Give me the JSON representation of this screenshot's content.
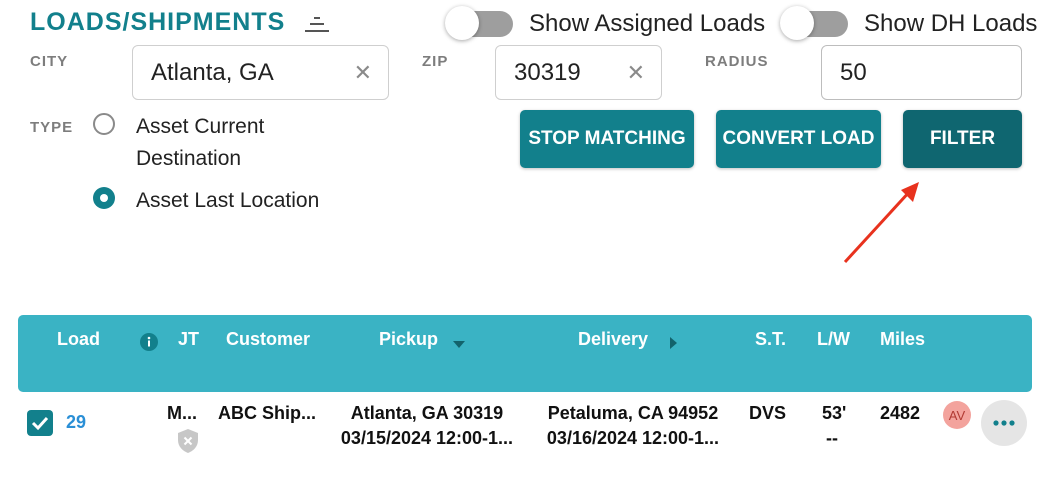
{
  "header": {
    "title": "LOADS/SHIPMENTS",
    "show_assigned_label": "Show Assigned Loads",
    "show_dh_label": "Show DH Loads"
  },
  "filters": {
    "city_label": "CITY",
    "city_value": "Atlanta, GA",
    "zip_label": "ZIP",
    "zip_value": "30319",
    "radius_label": "RADIUS",
    "radius_value": "50",
    "type_label": "TYPE",
    "type_option_1_line1": "Asset Current",
    "type_option_1_line2": "Destination",
    "type_option_2": "Asset Last Location",
    "clear_glyph": "✕"
  },
  "buttons": {
    "stop_matching": "STOP MATCHING",
    "convert_load": "CONVERT LOAD",
    "filter": "FILTER"
  },
  "table": {
    "headers": {
      "load": "Load",
      "jt": "JT",
      "customer": "Customer",
      "pickup": "Pickup",
      "delivery": "Delivery",
      "st": "S.T.",
      "lw": "L/W",
      "miles": "Miles"
    },
    "row": {
      "load": "29",
      "jt": "M...",
      "customer": "ABC Ship...",
      "pickup_city": "Atlanta, GA 30319",
      "pickup_time": "03/15/2024 12:00-1...",
      "delivery_city": "Petaluma, CA 94952",
      "delivery_time": "03/16/2024 12:00-1...",
      "st": "DVS",
      "lw_top": "53'",
      "lw_bottom": "--",
      "miles": "2482",
      "avatar": "AV"
    }
  },
  "colors": {
    "accent": "#12808c",
    "accent_dark": "#0f6670",
    "table_header": "#3ab3c4",
    "annotation_arrow": "#e8321e"
  }
}
